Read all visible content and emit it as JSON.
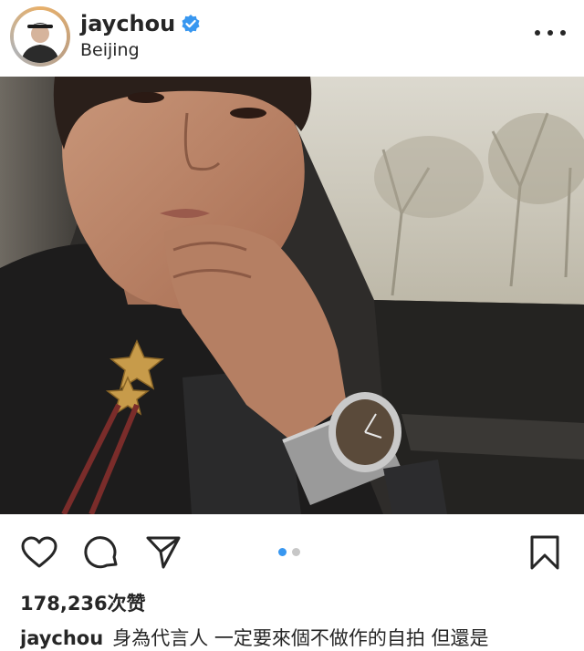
{
  "post": {
    "username": "jaychou",
    "location": "Beijing",
    "verified": true,
    "likes_text": "178,236次赞",
    "caption_user": "jaychou",
    "caption_text": "身為代言人 一定要來個不做作的自拍 但還是"
  },
  "carousel": {
    "total": 2,
    "active_index": 0
  },
  "icons": {
    "verified": "verified-badge-icon",
    "more": "more-options-icon",
    "like": "heart-icon",
    "comment": "comment-bubble-icon",
    "share": "paper-plane-icon",
    "save": "bookmark-icon"
  },
  "colors": {
    "text": "#262626",
    "verified": "#3897f0",
    "dot_active": "#3897f0",
    "dot_inactive": "#c7c7c7"
  }
}
